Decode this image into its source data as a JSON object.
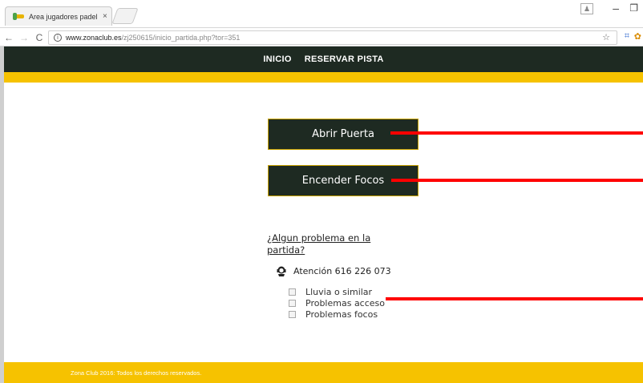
{
  "browser": {
    "tab_title": "Area jugadores padel",
    "tab_close": "×",
    "url_host": "www.zonaclub.es",
    "url_path": "/zj250615/inicio_partida.php?tor=351"
  },
  "nav": {
    "items": [
      {
        "label": "INICIO"
      },
      {
        "label": "RESERVAR PISTA"
      }
    ]
  },
  "actions": {
    "open_door": "Abrir Puerta",
    "turn_on_lights": "Encender Focos"
  },
  "problems": {
    "link_text": "¿Algun problema en la partida?",
    "phone_label": "Atención 616 226 073",
    "options": [
      {
        "label": "Lluvia o similar",
        "checked": false
      },
      {
        "label": "Problemas acceso",
        "checked": false
      },
      {
        "label": "Problemas focos",
        "checked": false
      }
    ]
  },
  "footer": {
    "text": "Zona Club 2016: Todos los derechos reservados."
  },
  "colors": {
    "nav_bg": "#1e2a22",
    "gold": "#f6c200",
    "annotation_red": "#ff0000"
  }
}
